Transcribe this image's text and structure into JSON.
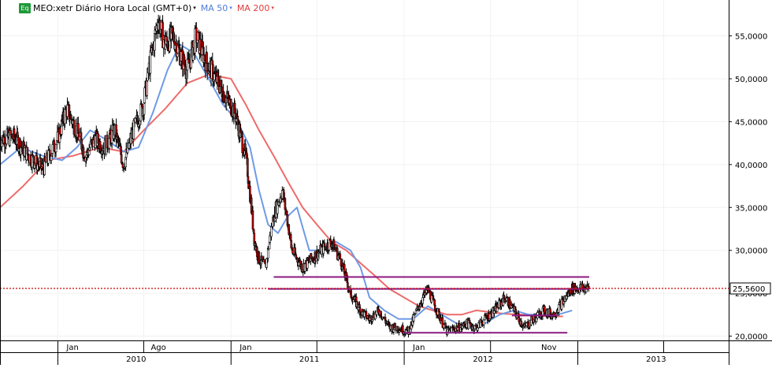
{
  "header": {
    "badge": "Eq",
    "symbol_label": "MEO:xetr Diário Hora Local (GMT+0)",
    "ma50_label": "MA 50",
    "ma200_label": "MA 200",
    "caret": "▾"
  },
  "colors": {
    "price": "#000000",
    "up_candle": "#ffffff",
    "down_candle": "#cc0000",
    "ma50": "#6f9ae6",
    "ma200": "#ee6b6b",
    "level_lines": "#8b1a7f",
    "last_price_line": "#cc0000"
  },
  "chart_data": {
    "type": "line",
    "ylim": [
      19.5,
      59
    ],
    "yticks": [
      "20,0000",
      "25,0000",
      "30,0000",
      "35,0000",
      "40,0000",
      "45,0000",
      "50,0000",
      "55,0000"
    ],
    "ytick_values": [
      20,
      25,
      30,
      35,
      40,
      45,
      50,
      55
    ],
    "last_price_label": "25,5600",
    "last_price": 25.56,
    "x_month_labels": [
      "Jan",
      "Ago",
      "Jan",
      "Jan",
      "Nov"
    ],
    "x_month_dates": [
      "2010-02-01",
      "2010-08-01",
      "2011-02-01",
      "2012-02-01",
      "2012-11-01"
    ],
    "x_year_labels": [
      "2010",
      "2011",
      "2012",
      "2013"
    ],
    "x_year_dates": [
      "2010-06-15",
      "2011-06-15",
      "2012-06-15",
      "2013-06-15"
    ],
    "x_range": [
      "2009-09-01",
      "2013-11-15"
    ],
    "series": [
      {
        "dates": [
          "2009-09-01",
          "2009-10-01",
          "2009-11-01",
          "2009-12-01",
          "2010-01-01",
          "2010-01-20",
          "2010-02-10",
          "2010-03-01",
          "2010-03-20",
          "2010-04-10",
          "2010-05-01",
          "2010-05-20",
          "2010-06-10",
          "2010-07-01",
          "2010-07-15",
          "2010-08-01",
          "2010-08-15",
          "2010-09-01",
          "2010-09-15",
          "2010-10-01",
          "2010-10-20",
          "2010-11-10",
          "2010-12-01",
          "2010-12-20",
          "2011-01-10",
          "2011-02-01",
          "2011-02-10",
          "2011-02-20",
          "2011-03-01",
          "2011-03-15",
          "2011-04-01",
          "2011-04-20",
          "2011-05-10",
          "2011-06-01",
          "2011-06-20",
          "2011-07-10",
          "2011-08-01",
          "2011-08-20",
          "2011-09-10",
          "2011-10-01",
          "2011-10-20",
          "2011-11-10",
          "2011-12-01",
          "2011-12-20",
          "2012-01-10",
          "2012-02-01",
          "2012-02-20",
          "2012-03-10",
          "2012-04-01",
          "2012-04-20",
          "2012-05-01",
          "2012-05-10",
          "2012-06-01",
          "2012-06-20",
          "2012-07-10",
          "2012-08-01",
          "2012-08-20",
          "2012-09-10",
          "2012-10-01",
          "2012-10-20",
          "2012-11-10",
          "2012-12-01",
          "2012-12-20",
          "2013-01-10",
          "2013-01-25",
          "2013-02-01"
        ],
        "values": [
          43,
          43.2,
          41,
          39.5,
          43,
          46.5,
          44,
          41,
          43,
          42,
          44,
          40,
          44,
          47,
          52,
          57,
          54,
          55,
          53,
          51,
          55,
          52,
          50,
          48,
          46,
          41,
          37,
          31,
          29,
          28,
          34,
          37,
          30,
          28,
          29,
          30,
          31,
          29,
          25,
          23,
          22,
          23,
          21,
          21,
          20.5,
          23.5,
          25.5,
          23,
          20.5,
          21,
          21,
          21.5,
          21,
          22,
          23,
          24.5,
          23,
          21,
          22,
          23,
          22.5,
          24,
          25.56,
          25.56,
          25.56,
          25.56
        ]
      },
      {
        "name": "MA 50",
        "dates": [
          "2009-09-01",
          "2009-10-15",
          "2009-12-01",
          "2010-01-10",
          "2010-02-10",
          "2010-03-10",
          "2010-04-10",
          "2010-05-20",
          "2010-06-20",
          "2010-07-20",
          "2010-08-20",
          "2010-09-15",
          "2010-10-15",
          "2010-11-15",
          "2010-12-15",
          "2011-01-15",
          "2011-02-10",
          "2011-03-01",
          "2011-03-20",
          "2011-04-10",
          "2011-05-01",
          "2011-05-20",
          "2011-06-15",
          "2011-07-10",
          "2011-08-10",
          "2011-09-10",
          "2011-10-01",
          "2011-10-20",
          "2011-11-20",
          "2011-12-20",
          "2012-01-20",
          "2012-02-20",
          "2012-03-20",
          "2012-04-20",
          "2012-05-20",
          "2012-06-20",
          "2012-07-20",
          "2012-08-20",
          "2012-09-20",
          "2012-10-20",
          "2012-11-20",
          "2012-12-20"
        ],
        "values": [
          40,
          42,
          41,
          40.5,
          42,
          44,
          43,
          41.5,
          42,
          46,
          51,
          54,
          53,
          50,
          47,
          45,
          42,
          37,
          33,
          32,
          34,
          35,
          30,
          30,
          31,
          30,
          28,
          24.5,
          23,
          22,
          22,
          23.5,
          22.5,
          21.5,
          21,
          21.5,
          22.5,
          23,
          22.5,
          22.5,
          22.5,
          23
        ]
      },
      {
        "name": "MA 200",
        "dates": [
          "2009-09-01",
          "2009-10-20",
          "2009-12-10",
          "2010-02-01",
          "2010-04-01",
          "2010-05-20",
          "2010-07-01",
          "2010-08-15",
          "2010-10-01",
          "2010-11-15",
          "2011-01-01",
          "2011-02-01",
          "2011-03-01",
          "2011-04-01",
          "2011-05-01",
          "2011-06-01",
          "2011-07-01",
          "2011-08-01",
          "2011-09-01",
          "2011-10-01",
          "2011-11-01",
          "2011-12-01",
          "2012-01-01",
          "2012-02-01",
          "2012-03-01",
          "2012-04-01",
          "2012-05-01",
          "2012-06-01",
          "2012-07-01",
          "2012-08-01",
          "2012-09-01",
          "2012-10-01",
          "2012-11-01",
          "2012-12-01"
        ],
        "values": [
          35,
          37.5,
          40.5,
          41,
          42,
          41.5,
          44,
          46.5,
          49.5,
          50.5,
          50,
          47,
          44,
          41,
          38,
          35,
          33,
          31,
          30,
          28.5,
          27,
          25.5,
          24.5,
          23.5,
          23,
          22.5,
          22.5,
          23,
          22.8,
          22.6,
          22.5,
          22.4,
          22.3,
          22.3
        ]
      }
    ],
    "horizontal_levels": [
      {
        "value": 26.9,
        "start": "2011-04-01",
        "end": "2013-01-25"
      },
      {
        "value": 25.5,
        "start": "2011-03-20",
        "end": "2013-01-25"
      },
      {
        "value": 20.4,
        "start": "2012-01-01",
        "end": "2012-12-10"
      },
      {
        "value": 22.4,
        "start": "2012-08-15",
        "end": "2012-11-20"
      }
    ]
  }
}
